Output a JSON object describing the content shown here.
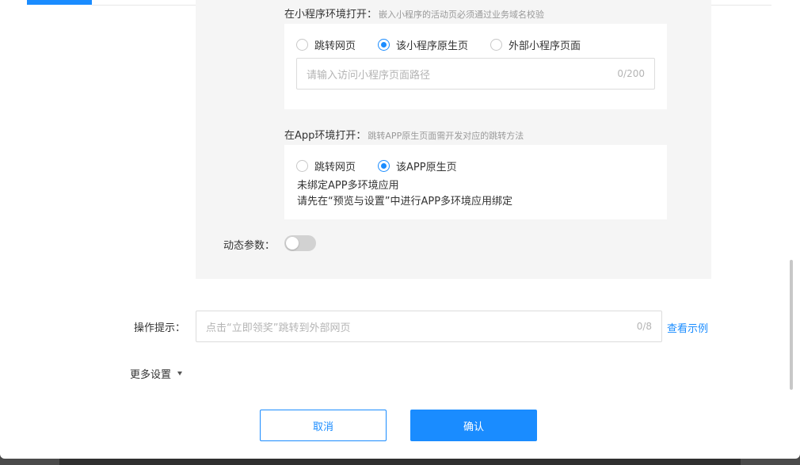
{
  "miniprogram": {
    "title": "在小程序环境打开：",
    "hint": "嵌入小程序的活动页必须通过业务域名校验",
    "options": [
      "跳转网页",
      "该小程序原生页",
      "外部小程序页面"
    ],
    "path_placeholder": "请输入访问小程序页面路径",
    "path_count": "0/200"
  },
  "app": {
    "title": "在App环境打开：",
    "hint": "跳转APP原生页面需开发对应的跳转方法",
    "options": [
      "跳转网页",
      "该APP原生页"
    ],
    "note_line1": "未绑定APP多环境应用",
    "note_line2": "请先在“预览与设置”中进行APP多环境应用绑定"
  },
  "dynamic_params": {
    "label": "动态参数：",
    "enabled": false
  },
  "tip": {
    "label": "操作提示：",
    "placeholder": "点击“立即领奖”跳转到外部网页",
    "count": "0/8",
    "example_link": "查看示例"
  },
  "more_settings": {
    "label": "更多设置"
  },
  "actions": {
    "cancel": "取消",
    "confirm": "确认"
  },
  "colors": {
    "accent": "#1a8cff",
    "panel_bg": "#f5f5f5"
  }
}
